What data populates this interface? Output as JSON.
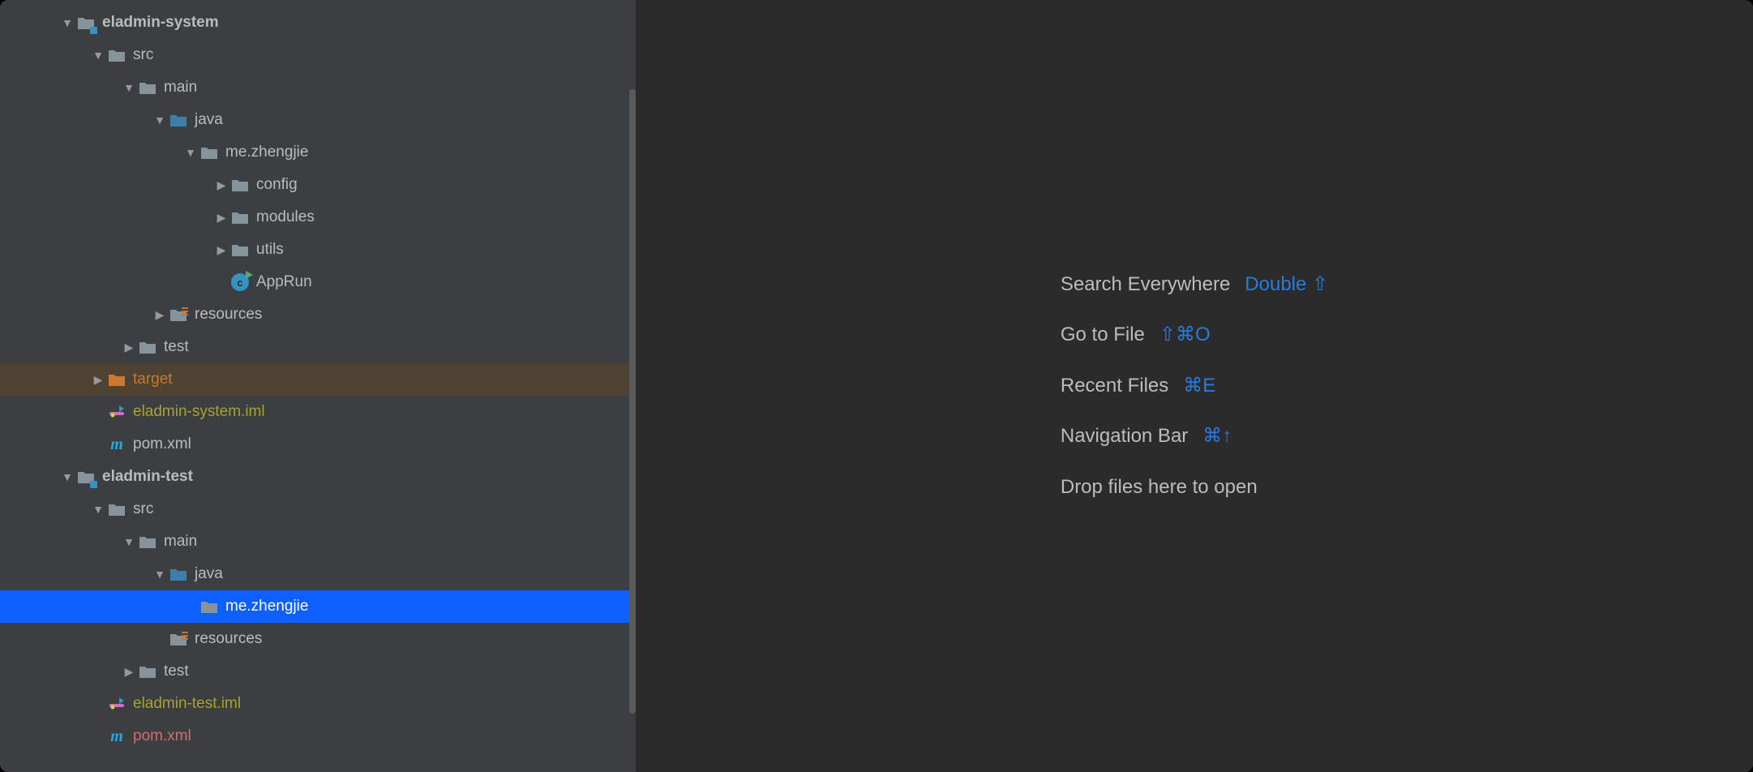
{
  "tree": [
    {
      "indent": 0,
      "arrow": "down",
      "icon": "module",
      "label": "eladmin-system",
      "style": "bold"
    },
    {
      "indent": 1,
      "arrow": "down",
      "icon": "folder",
      "label": "src"
    },
    {
      "indent": 2,
      "arrow": "down",
      "icon": "folder",
      "label": "main"
    },
    {
      "indent": 3,
      "arrow": "down",
      "icon": "source-folder",
      "label": "java"
    },
    {
      "indent": 4,
      "arrow": "down",
      "icon": "folder",
      "label": "me.zhengjie"
    },
    {
      "indent": 5,
      "arrow": "right",
      "icon": "folder",
      "label": "config"
    },
    {
      "indent": 5,
      "arrow": "right",
      "icon": "folder",
      "label": "modules"
    },
    {
      "indent": 5,
      "arrow": "right",
      "icon": "folder",
      "label": "utils"
    },
    {
      "indent": 5,
      "arrow": "none",
      "icon": "class-run",
      "label": "AppRun"
    },
    {
      "indent": 3,
      "arrow": "right",
      "icon": "resources",
      "label": "resources"
    },
    {
      "indent": 2,
      "arrow": "right",
      "icon": "folder",
      "label": "test"
    },
    {
      "indent": 1,
      "arrow": "right",
      "icon": "folder-orange",
      "label": "target",
      "style": "orange",
      "row_style": "highlighted"
    },
    {
      "indent": 1,
      "arrow": "none",
      "icon": "iml",
      "label": "eladmin-system.iml",
      "style": "olive"
    },
    {
      "indent": 1,
      "arrow": "none",
      "icon": "maven",
      "label": "pom.xml"
    },
    {
      "indent": 0,
      "arrow": "down",
      "icon": "module",
      "label": "eladmin-test",
      "style": "bold"
    },
    {
      "indent": 1,
      "arrow": "down",
      "icon": "folder",
      "label": "src"
    },
    {
      "indent": 2,
      "arrow": "down",
      "icon": "folder",
      "label": "main"
    },
    {
      "indent": 3,
      "arrow": "down",
      "icon": "source-folder",
      "label": "java"
    },
    {
      "indent": 4,
      "arrow": "none",
      "icon": "folder",
      "label": "me.zhengjie",
      "row_style": "selected"
    },
    {
      "indent": 3,
      "arrow": "none",
      "icon": "resources",
      "label": "resources"
    },
    {
      "indent": 2,
      "arrow": "right",
      "icon": "folder",
      "label": "test"
    },
    {
      "indent": 1,
      "arrow": "none",
      "icon": "iml",
      "label": "eladmin-test.iml",
      "style": "olive"
    },
    {
      "indent": 1,
      "arrow": "none",
      "icon": "maven",
      "label": "pom.xml",
      "style": "red"
    }
  ],
  "welcome": {
    "items": [
      {
        "label": "Search Everywhere",
        "shortcut": "Double ⇧"
      },
      {
        "label": "Go to File",
        "shortcut": "⇧⌘O"
      },
      {
        "label": "Recent Files",
        "shortcut": "⌘E"
      },
      {
        "label": "Navigation Bar",
        "shortcut": "⌘↑"
      },
      {
        "label": "Drop files here to open",
        "shortcut": ""
      }
    ]
  }
}
